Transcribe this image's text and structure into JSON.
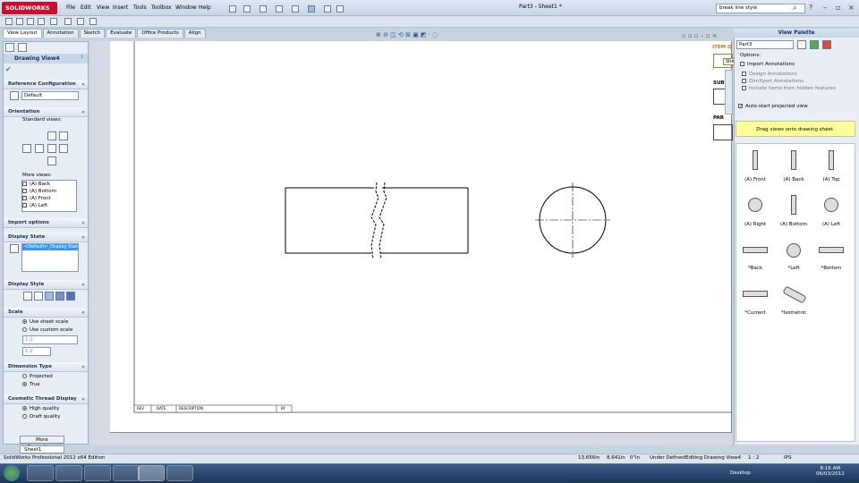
{
  "app": {
    "logo": "SOLIDWORKS",
    "menus": [
      "File",
      "Edit",
      "View",
      "Insert",
      "Tools",
      "Toolbox",
      "Window",
      "Help"
    ],
    "doc_title": "Part3 - Sheet1 *",
    "search_placeholder": "break line style"
  },
  "tabs": [
    "View Layout",
    "Annotation",
    "Sketch",
    "Evaluate",
    "Office Products",
    "Align"
  ],
  "left_panel": {
    "title": "Drawing View4",
    "help": "?",
    "reference_config": {
      "header": "Reference Configuration",
      "value": "Default"
    },
    "orientation": {
      "header": "Orientation",
      "standard_label": "Standard views:",
      "more_label": "More views:",
      "more_views": [
        "(A) Back",
        "(A) Bottom",
        "(A) Front",
        "(A) Left"
      ]
    },
    "import_options": {
      "header": "Import options"
    },
    "display_state": {
      "header": "Display State",
      "selected": "<Default>_Display State"
    },
    "display_style": {
      "header": "Display Style"
    },
    "scale": {
      "header": "Scale",
      "opt1": "Use sheet scale",
      "opt2": "Use custom scale",
      "custom_value": "1:2",
      "custom_value2": "1:2"
    },
    "dimension_type": {
      "header": "Dimension Type",
      "opt1": "Projected",
      "opt2": "True"
    },
    "cosmetic_thread": {
      "header": "Cosmetic Thread Display",
      "opt1": "High quality",
      "opt2": "Draft quality"
    },
    "more_properties": "More Properties..."
  },
  "sheet": {
    "tab_label": "Sheet1",
    "title_block": {
      "rev": "REV",
      "date": "DATE",
      "description": "DESCRIPTION",
      "by": "BY"
    },
    "right_labels": {
      "item": "ITEM Q",
      "sub": "SUB",
      "part": "PAR"
    },
    "tooltip": "Sheet1"
  },
  "view_palette": {
    "title": "View Palette",
    "part_select": "Part3",
    "options_label": "Options:",
    "import_annotations": "Import Annotations",
    "design_annotations": "Design Annotations",
    "dimxpert_annotations": "DimXpert Annotations",
    "hidden_features": "Include items from hidden features",
    "auto_start": "Auto-start projected view",
    "hint": "Drag views onto drawing sheet.",
    "views": [
      "(A) Front",
      "(A) Back",
      "(A) Top",
      "(A) Right",
      "(A) Bottom",
      "(A) Left",
      "*Back",
      "*Left",
      "*Bottom",
      "*Current",
      "*Isometric"
    ]
  },
  "status": {
    "edition": "SolidWorks Professional 2012 x64 Edition",
    "x": "13.656in",
    "y": "8.641in",
    "z": "0\"in",
    "state": "Under Defined",
    "editing": "Editing Drawing View4",
    "scale": "1 : 2",
    "units": "IPS"
  },
  "taskbar": {
    "desktop": "Desktop",
    "time": "8:16 AM",
    "date": "06/03/2012"
  }
}
